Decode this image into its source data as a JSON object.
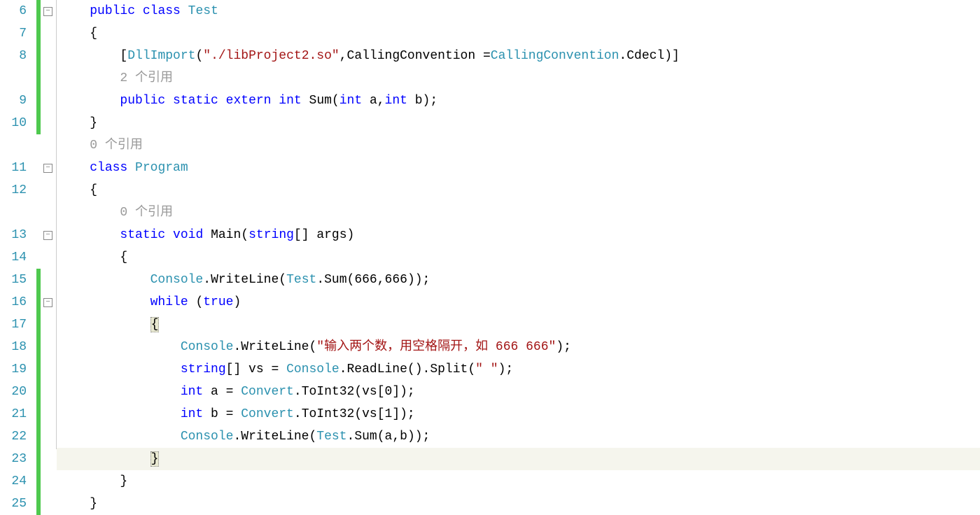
{
  "lineNumbers": [
    "6",
    "7",
    "8",
    "",
    "9",
    "10",
    "",
    "11",
    "12",
    "",
    "13",
    "14",
    "15",
    "16",
    "17",
    "18",
    "19",
    "20",
    "21",
    "22",
    "23",
    "24",
    "25"
  ],
  "changeMarks": [
    {
      "start": 0,
      "end": 6
    },
    {
      "start": 12,
      "end": 23
    }
  ],
  "foldIcons": [
    {
      "line": 0,
      "symbol": "−"
    },
    {
      "line": 7,
      "symbol": "−"
    },
    {
      "line": 10,
      "symbol": "−"
    },
    {
      "line": 13,
      "symbol": "−"
    }
  ],
  "code": {
    "l0": {
      "indent": "    ",
      "tokens": [
        {
          "t": "public",
          "c": "kw"
        },
        {
          "t": " ",
          "c": "punct"
        },
        {
          "t": "class",
          "c": "kw"
        },
        {
          "t": " ",
          "c": "punct"
        },
        {
          "t": "Test",
          "c": "type"
        }
      ]
    },
    "l1": {
      "indent": "    ",
      "tokens": [
        {
          "t": "{",
          "c": "punct"
        }
      ]
    },
    "l2": {
      "indent": "        ",
      "tokens": [
        {
          "t": "[",
          "c": "punct"
        },
        {
          "t": "DllImport",
          "c": "type"
        },
        {
          "t": "(",
          "c": "punct"
        },
        {
          "t": "\"./libProject2.so\"",
          "c": "str"
        },
        {
          "t": ",",
          "c": "punct"
        },
        {
          "t": "CallingConvention ",
          "c": "ident"
        },
        {
          "t": "=",
          "c": "punct"
        },
        {
          "t": "CallingConvention",
          "c": "type"
        },
        {
          "t": ".",
          "c": "punct"
        },
        {
          "t": "Cdecl",
          "c": "ident"
        },
        {
          "t": ")]",
          "c": "punct"
        }
      ]
    },
    "l3": {
      "indent": "        ",
      "tokens": [
        {
          "t": "2 个引用",
          "c": "comment-ref"
        }
      ]
    },
    "l4": {
      "indent": "        ",
      "tokens": [
        {
          "t": "public",
          "c": "kw"
        },
        {
          "t": " ",
          "c": "punct"
        },
        {
          "t": "static",
          "c": "kw"
        },
        {
          "t": " ",
          "c": "punct"
        },
        {
          "t": "extern",
          "c": "kw"
        },
        {
          "t": " ",
          "c": "punct"
        },
        {
          "t": "int",
          "c": "kw"
        },
        {
          "t": " ",
          "c": "punct"
        },
        {
          "t": "Sum",
          "c": "ident"
        },
        {
          "t": "(",
          "c": "punct"
        },
        {
          "t": "int",
          "c": "kw"
        },
        {
          "t": " a,",
          "c": "punct"
        },
        {
          "t": "int",
          "c": "kw"
        },
        {
          "t": " b);",
          "c": "punct"
        }
      ]
    },
    "l5": {
      "indent": "    ",
      "tokens": [
        {
          "t": "}",
          "c": "punct"
        }
      ]
    },
    "l6": {
      "indent": "    ",
      "tokens": [
        {
          "t": "0 个引用",
          "c": "comment-ref"
        }
      ]
    },
    "l7": {
      "indent": "    ",
      "tokens": [
        {
          "t": "class",
          "c": "kw"
        },
        {
          "t": " ",
          "c": "punct"
        },
        {
          "t": "Program",
          "c": "type"
        }
      ]
    },
    "l8": {
      "indent": "    ",
      "tokens": [
        {
          "t": "{",
          "c": "punct"
        }
      ]
    },
    "l9": {
      "indent": "        ",
      "tokens": [
        {
          "t": "0 个引用",
          "c": "comment-ref"
        }
      ]
    },
    "l10": {
      "indent": "        ",
      "tokens": [
        {
          "t": "static",
          "c": "kw"
        },
        {
          "t": " ",
          "c": "punct"
        },
        {
          "t": "void",
          "c": "kw"
        },
        {
          "t": " ",
          "c": "punct"
        },
        {
          "t": "Main",
          "c": "ident"
        },
        {
          "t": "(",
          "c": "punct"
        },
        {
          "t": "string",
          "c": "kw"
        },
        {
          "t": "[] args)",
          "c": "punct"
        }
      ]
    },
    "l11": {
      "indent": "        ",
      "tokens": [
        {
          "t": "{",
          "c": "punct"
        }
      ]
    },
    "l12": {
      "indent": "            ",
      "tokens": [
        {
          "t": "Console",
          "c": "type"
        },
        {
          "t": ".",
          "c": "punct"
        },
        {
          "t": "WriteLine",
          "c": "ident"
        },
        {
          "t": "(",
          "c": "punct"
        },
        {
          "t": "Test",
          "c": "type"
        },
        {
          "t": ".",
          "c": "punct"
        },
        {
          "t": "Sum",
          "c": "ident"
        },
        {
          "t": "(666,666));",
          "c": "punct"
        }
      ]
    },
    "l13": {
      "indent": "            ",
      "tokens": [
        {
          "t": "while",
          "c": "kw"
        },
        {
          "t": " (",
          "c": "punct"
        },
        {
          "t": "true",
          "c": "kw"
        },
        {
          "t": ")",
          "c": "punct"
        }
      ]
    },
    "l14": {
      "indent": "            ",
      "tokens": [
        {
          "t": "{",
          "c": "punct brace-match"
        }
      ]
    },
    "l15": {
      "indent": "                ",
      "tokens": [
        {
          "t": "Console",
          "c": "type"
        },
        {
          "t": ".",
          "c": "punct"
        },
        {
          "t": "WriteLine",
          "c": "ident"
        },
        {
          "t": "(",
          "c": "punct"
        },
        {
          "t": "\"输入两个数，用空格隔开，如 666 666\"",
          "c": "str"
        },
        {
          "t": ");",
          "c": "punct"
        }
      ]
    },
    "l16": {
      "indent": "                ",
      "tokens": [
        {
          "t": "string",
          "c": "kw"
        },
        {
          "t": "[] vs = ",
          "c": "punct"
        },
        {
          "t": "Console",
          "c": "type"
        },
        {
          "t": ".",
          "c": "punct"
        },
        {
          "t": "ReadLine",
          "c": "ident"
        },
        {
          "t": "().",
          "c": "punct"
        },
        {
          "t": "Split",
          "c": "ident"
        },
        {
          "t": "(",
          "c": "punct"
        },
        {
          "t": "\" \"",
          "c": "str"
        },
        {
          "t": ");",
          "c": "punct"
        }
      ]
    },
    "l17": {
      "indent": "                ",
      "tokens": [
        {
          "t": "int",
          "c": "kw"
        },
        {
          "t": " a = ",
          "c": "punct"
        },
        {
          "t": "Convert",
          "c": "type"
        },
        {
          "t": ".",
          "c": "punct"
        },
        {
          "t": "ToInt32",
          "c": "ident"
        },
        {
          "t": "(vs[0]);",
          "c": "punct"
        }
      ]
    },
    "l18": {
      "indent": "                ",
      "tokens": [
        {
          "t": "int",
          "c": "kw"
        },
        {
          "t": " b = ",
          "c": "punct"
        },
        {
          "t": "Convert",
          "c": "type"
        },
        {
          "t": ".",
          "c": "punct"
        },
        {
          "t": "ToInt32",
          "c": "ident"
        },
        {
          "t": "(vs[1]);",
          "c": "punct"
        }
      ]
    },
    "l19": {
      "indent": "                ",
      "tokens": [
        {
          "t": "Console",
          "c": "type"
        },
        {
          "t": ".",
          "c": "punct"
        },
        {
          "t": "WriteLine",
          "c": "ident"
        },
        {
          "t": "(",
          "c": "punct"
        },
        {
          "t": "Test",
          "c": "type"
        },
        {
          "t": ".",
          "c": "punct"
        },
        {
          "t": "Sum",
          "c": "ident"
        },
        {
          "t": "(a,b));",
          "c": "punct"
        }
      ]
    },
    "l20": {
      "indent": "            ",
      "tokens": [
        {
          "t": "}",
          "c": "punct brace-match"
        }
      ],
      "highlighted": true
    },
    "l21": {
      "indent": "        ",
      "tokens": [
        {
          "t": "}",
          "c": "punct"
        }
      ]
    },
    "l22": {
      "indent": "    ",
      "tokens": [
        {
          "t": "}",
          "c": "punct"
        }
      ]
    }
  }
}
